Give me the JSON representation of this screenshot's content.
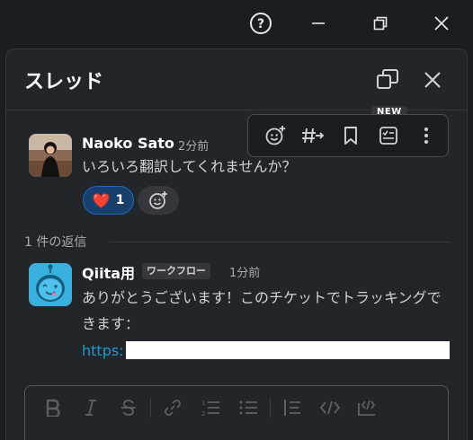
{
  "window": {
    "help_icon": "help-circle-icon",
    "minimize_icon": "minimize-icon",
    "maximize_icon": "restore-icon",
    "close_icon": "close-icon"
  },
  "thread": {
    "title": "スレッド",
    "popout_icon": "popout-icon",
    "close_icon": "close-icon"
  },
  "hover_toolbar": {
    "new_badge": "NEW",
    "actions": [
      "add-reaction",
      "forward-to-channel",
      "save-bookmark",
      "create-list-item",
      "more-actions"
    ]
  },
  "parent_message": {
    "author": "Naoko Sato",
    "time": "2分前",
    "text": "いろいろ翻訳してくれませんか？",
    "reaction_emoji": "❤️",
    "reaction_count": "1"
  },
  "replies": {
    "label": "1 件の返信"
  },
  "reply_message": {
    "author": "Qiita用",
    "badge": "ワークフロー",
    "time": "1分前",
    "text": "ありがとうございます！このチケットでトラッキングできます：",
    "link": "https:"
  },
  "composer": {
    "tools": [
      "bold",
      "italic",
      "strikethrough",
      "link",
      "ordered-list",
      "bulleted-list",
      "blockquote",
      "code",
      "code-block"
    ]
  },
  "colors": {
    "background": "#1a1d21",
    "panel": "#222529",
    "link": "#1d9bd1",
    "reaction_bg": "#18406b",
    "reaction_border": "#1d6ac4",
    "bot_avatar": "#39b0e0"
  }
}
